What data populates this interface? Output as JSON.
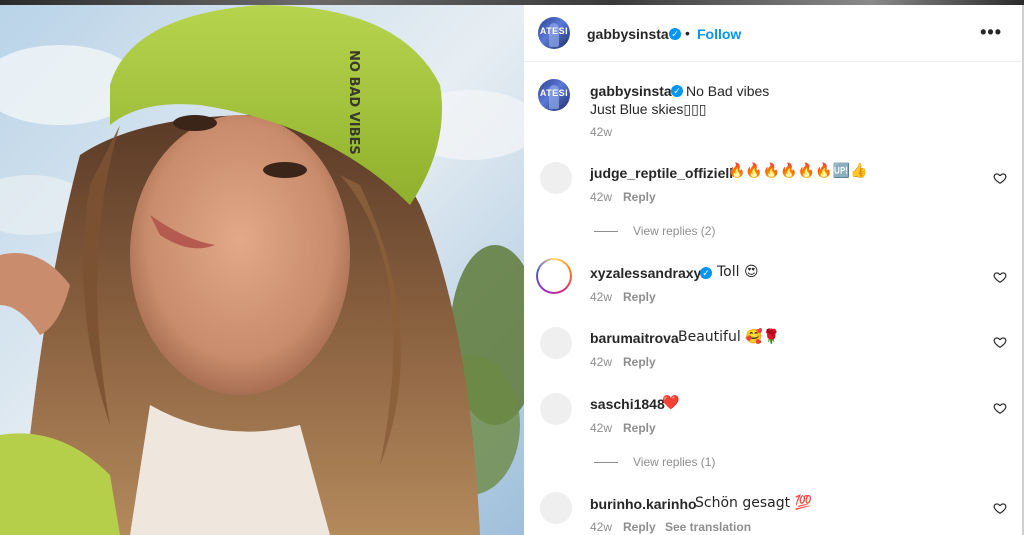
{
  "post": {
    "author": "gabbysinsta",
    "verified_icon": "verified-badge-icon",
    "follow_label": "Follow",
    "dot": "•",
    "more_icon": "more-options-icon",
    "more_glyph": "•••",
    "avatar_text": "ATESI"
  },
  "caption": {
    "username": "gabbysinsta",
    "line1": "No Bad vibes",
    "line2": "Just Blue skies▯▯▯",
    "time": "42w"
  },
  "comments": [
    {
      "username": "judge_reptile_offiziell",
      "text": "🔥🔥🔥🔥🔥🔥🆙👍",
      "time": "42w",
      "reply": "Reply",
      "view_replies": "View replies (2)",
      "verified": false
    },
    {
      "username": "xyzalessandraxyz",
      "text": "Toll 😍",
      "time": "42w",
      "reply": "Reply",
      "verified": true
    },
    {
      "username": "barumaitrova",
      "text": "Beautiful 🥰🌹",
      "time": "42w",
      "reply": "Reply",
      "verified": false
    },
    {
      "username": "saschi1848",
      "text": "❤️",
      "time": "42w",
      "reply": "Reply",
      "view_replies": "View replies (1)",
      "verified": false
    },
    {
      "username": "burinho.karinho",
      "text": "Schön gesagt 💯",
      "time": "42w",
      "reply": "Reply",
      "see_translation": "See translation",
      "verified": false
    }
  ],
  "icons": {
    "like": "heart-outline-icon"
  },
  "colors": {
    "link_blue": "#0095f6",
    "meta_gray": "#8e8e8e",
    "text": "#262626",
    "hat_green": "#a4c63c"
  }
}
